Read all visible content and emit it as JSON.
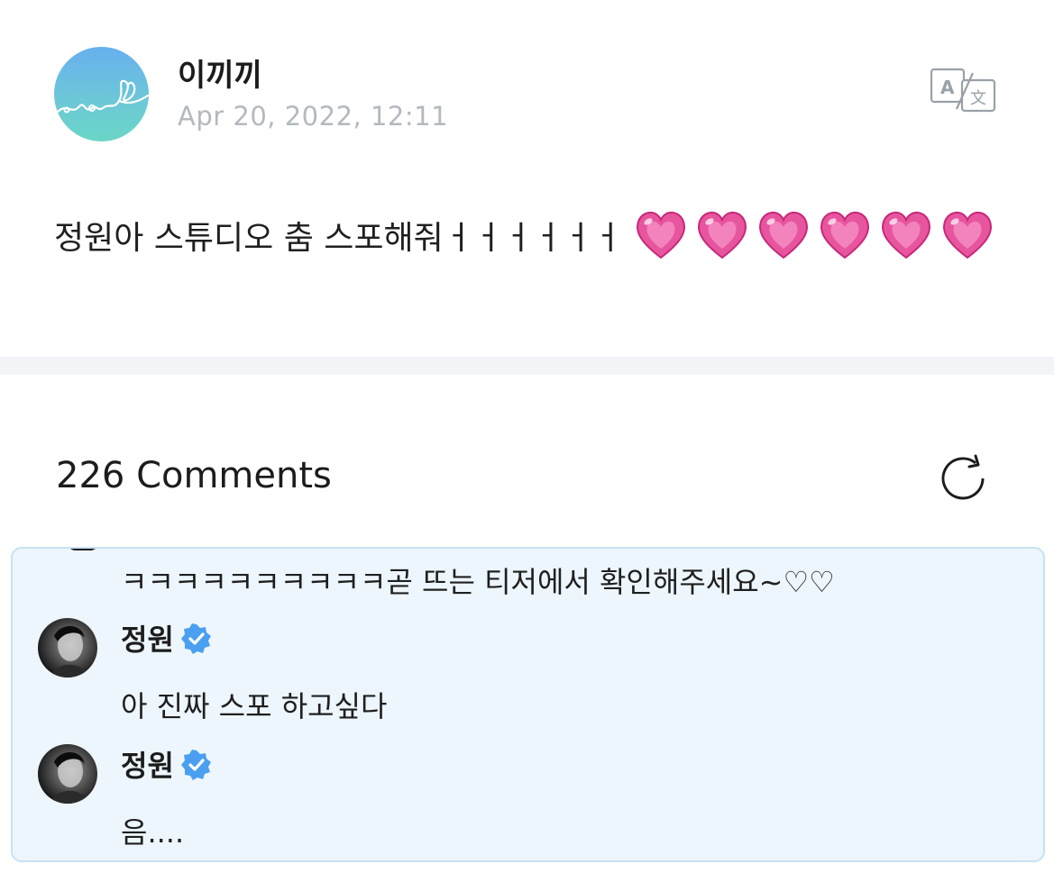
{
  "post": {
    "author": "이끼끼",
    "date": "Apr 20, 2022, 12:11",
    "text": "정원아 스튜디오 춤 스포해줘ㅓㅓㅓㅓㅓㅓ",
    "emoji_count": 6,
    "translate_icon": "translate-icon"
  },
  "comments": {
    "title": "226 Comments",
    "refresh_icon": "refresh-icon",
    "items": [
      {
        "text": "ㅋㅋㅋㅋㅋㅋㅋㅋㅋㅋ곧 뜨는 티저에서 확인해주세요~♡♡"
      },
      {
        "author": "정원",
        "verified": true,
        "text": "아 진짜 스포 하고싶다"
      },
      {
        "author": "정원",
        "verified": true,
        "text": "음...."
      }
    ]
  },
  "colors": {
    "panel_bg": "#edf6fc",
    "panel_border": "#c8e2f2",
    "verified_blue": "#4a9ff0",
    "heart_pink": "#e8559f",
    "date_gray": "#b4b8bf"
  }
}
